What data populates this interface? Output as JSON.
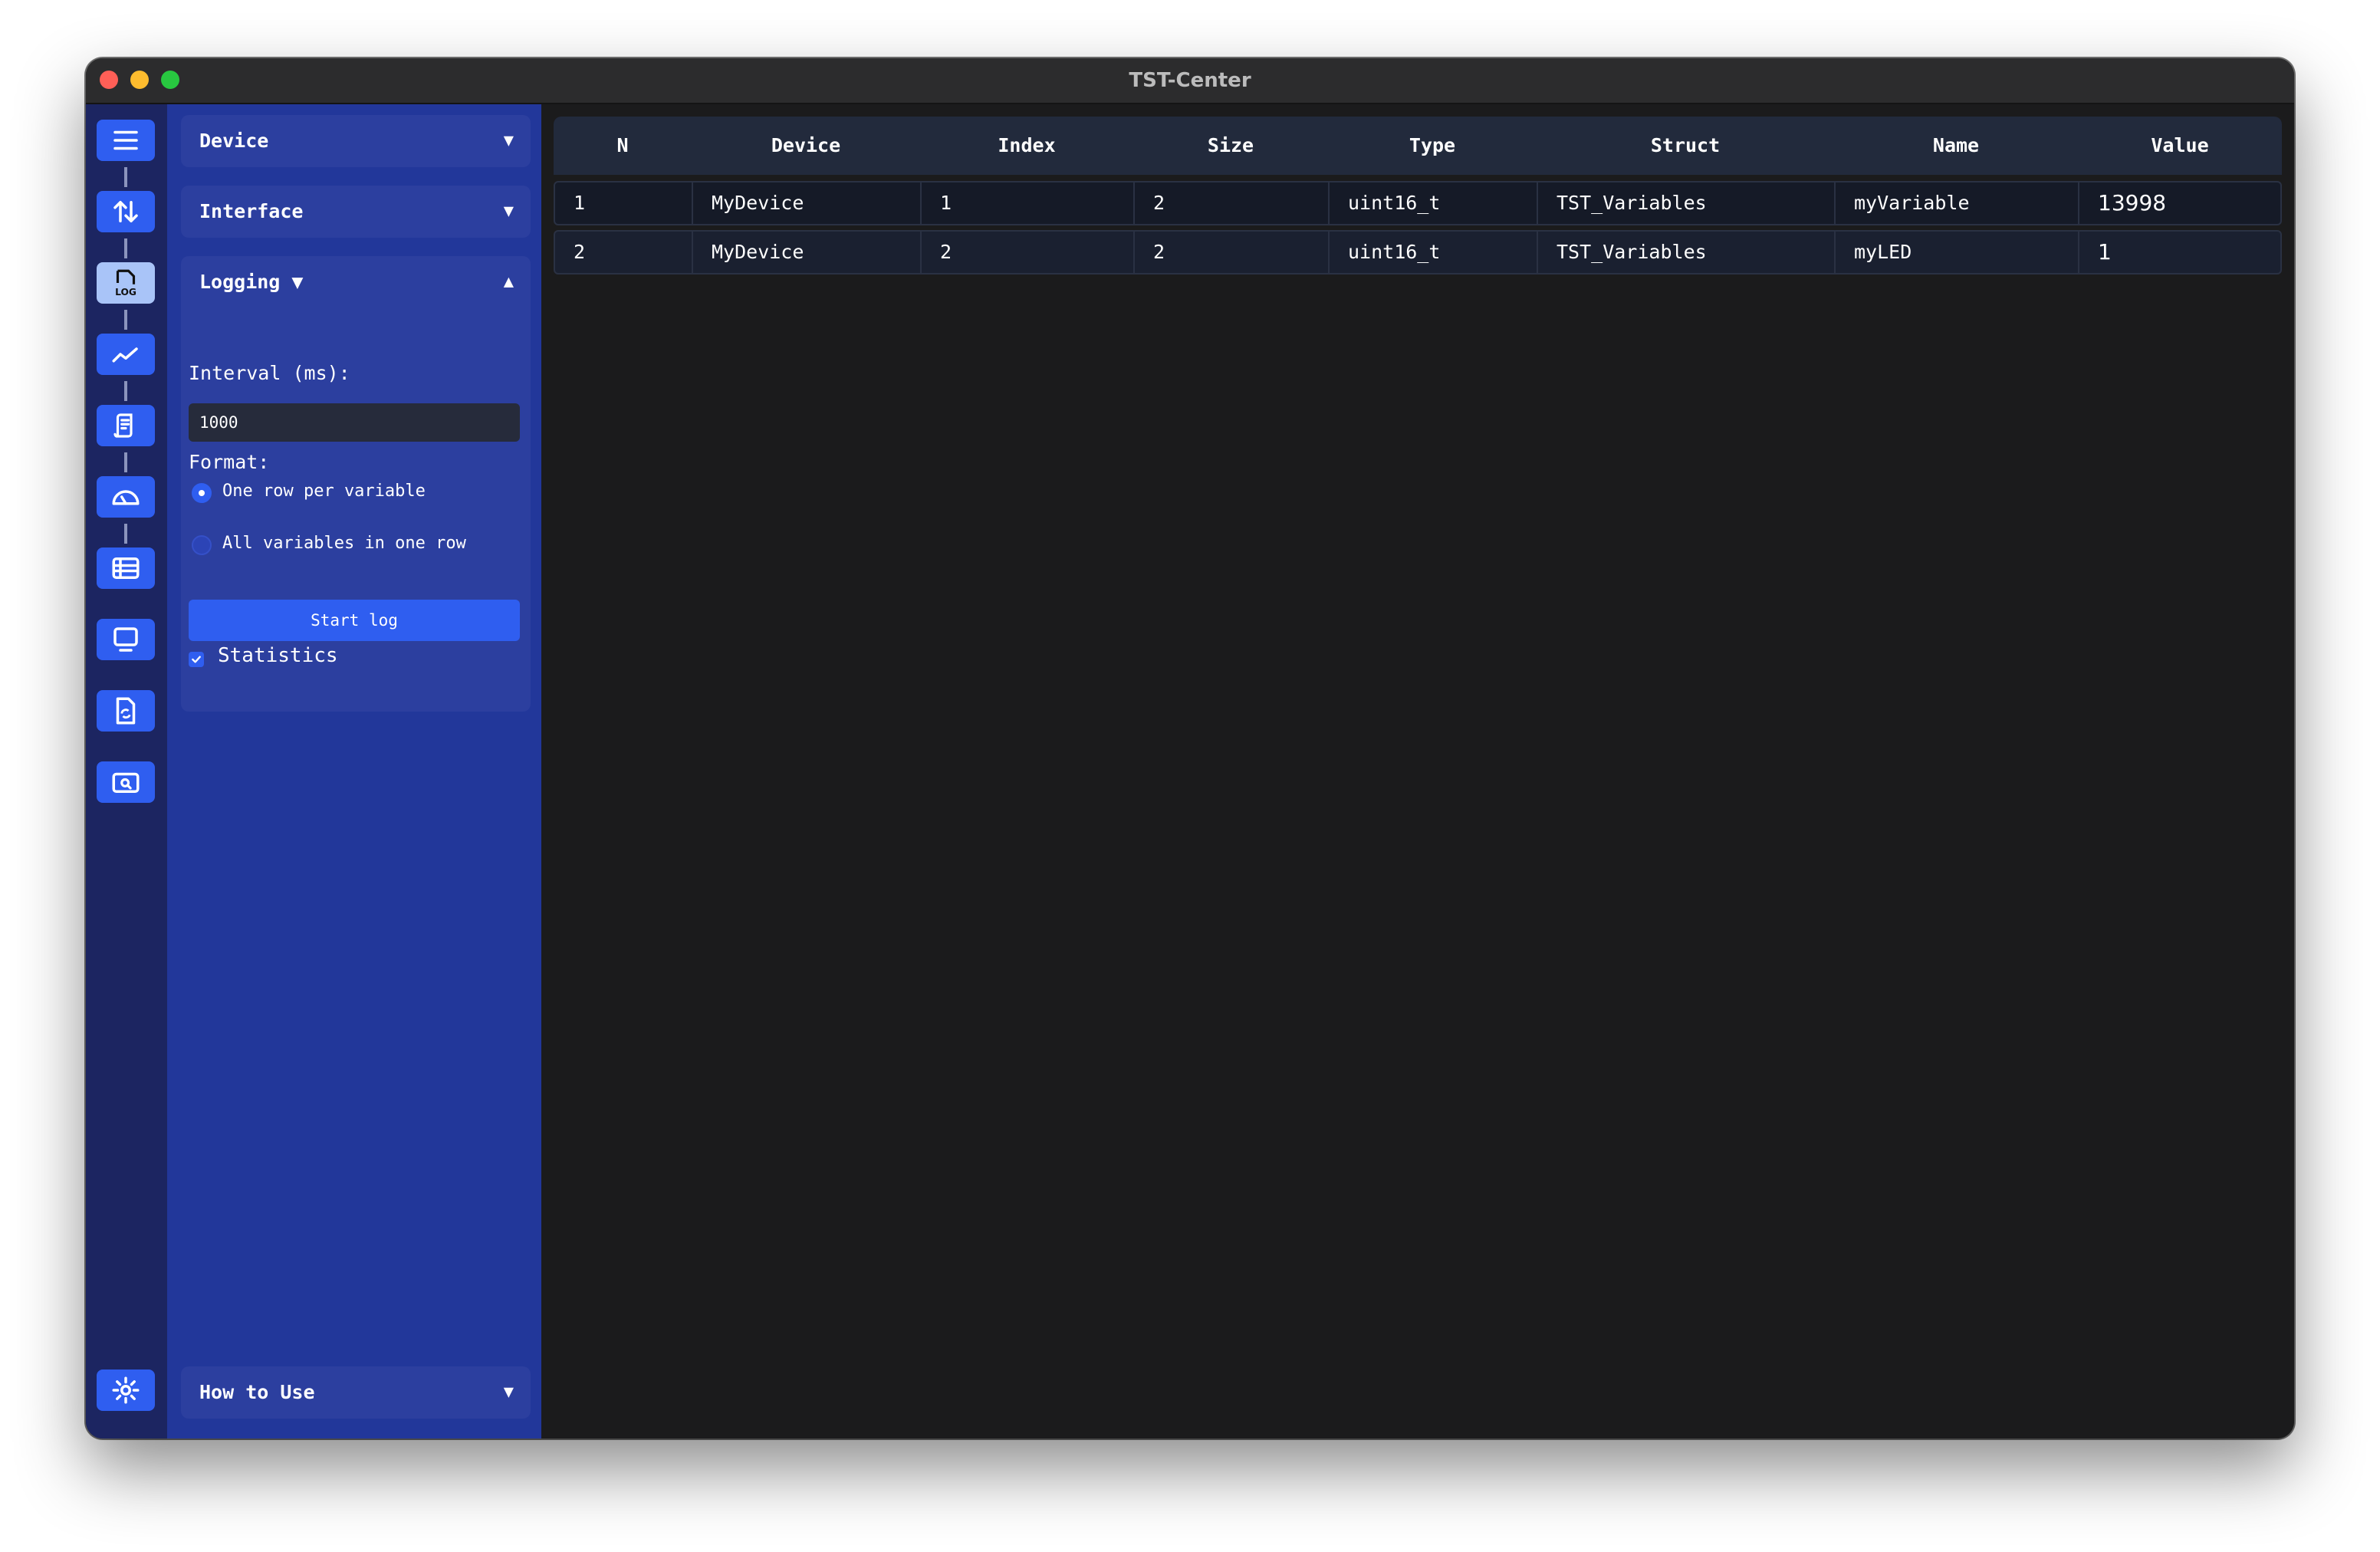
{
  "window": {
    "title": "TST-Center"
  },
  "rail": {
    "items": [
      {
        "icon": "menu-icon"
      },
      {
        "icon": "transfer-arrows-icon"
      },
      {
        "icon": "log-file-icon",
        "label": "LOG"
      },
      {
        "icon": "line-chart-icon"
      },
      {
        "icon": "document-icon"
      },
      {
        "icon": "gauge-icon"
      },
      {
        "icon": "table-icon"
      },
      {
        "icon": "monitor-icon"
      },
      {
        "icon": "file-sync-icon"
      },
      {
        "icon": "folder-search-icon"
      },
      {
        "icon": "gear-icon"
      }
    ]
  },
  "panel": {
    "device_label": "Device",
    "interface_label": "Interface",
    "logging_label": "Logging ▼",
    "howto_label": "How to Use",
    "arrow_down": "▼",
    "arrow_up": "▲",
    "interval_label": "Interval (ms):",
    "interval_value": "1000",
    "format_label": "Format:",
    "format_options": [
      "One row per variable",
      "All variables in one row"
    ],
    "format_selected": "One row per variable",
    "start_button": "Start log",
    "statistics_label": "Statistics",
    "statistics_checked": true
  },
  "table": {
    "columns": [
      "N",
      "Device",
      "Index",
      "Size",
      "Type",
      "Struct",
      "Name",
      "Value"
    ],
    "rows": [
      [
        "1",
        "MyDevice",
        "1",
        "2",
        "uint16_t",
        "TST_Variables",
        "myVariable",
        "13998"
      ],
      [
        "2",
        "MyDevice",
        "2",
        "2",
        "uint16_t",
        "TST_Variables",
        "myLED",
        "1"
      ]
    ]
  },
  "colors": {
    "rail_bg": "#1c2561",
    "panel_bg": "#22379a",
    "accent": "#2f5ef0",
    "main_bg": "#1b1b1c"
  }
}
